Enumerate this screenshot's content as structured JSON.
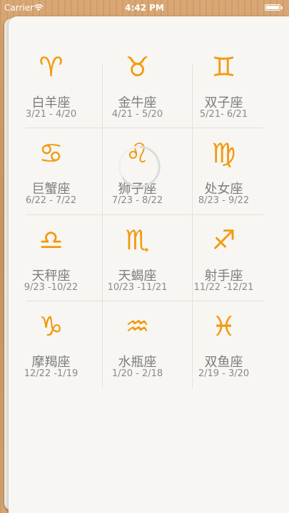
{
  "status_bar": {
    "carrier": "Carrier",
    "time": "4:42 PM"
  },
  "signs": [
    {
      "glyph": "♈",
      "name": "白羊座",
      "dates": "3/21 - 4/20",
      "icon": "aries-icon"
    },
    {
      "glyph": "♉",
      "name": "金牛座",
      "dates": "4/21 - 5/20",
      "icon": "taurus-icon"
    },
    {
      "glyph": "♊",
      "name": "双子座",
      "dates": "5/21- 6/21",
      "icon": "gemini-icon"
    },
    {
      "glyph": "♋",
      "name": "巨蟹座",
      "dates": "6/22 - 7/22",
      "icon": "cancer-icon"
    },
    {
      "glyph": "♌",
      "name": "狮子座",
      "dates": "7/23 - 8/22",
      "icon": "leo-icon"
    },
    {
      "glyph": "♍",
      "name": "处女座",
      "dates": "8/23 - 9/22",
      "icon": "virgo-icon"
    },
    {
      "glyph": "♎",
      "name": "天秤座",
      "dates": "9/23 -10/22",
      "icon": "libra-icon"
    },
    {
      "glyph": "♏",
      "name": "天蝎座",
      "dates": "10/23 -11/21",
      "icon": "scorpio-icon"
    },
    {
      "glyph": "♐",
      "name": "射手座",
      "dates": "11/22 -12/21",
      "icon": "sagittarius-icon"
    },
    {
      "glyph": "♑",
      "name": "摩羯座",
      "dates": "12/22 -1/19",
      "icon": "capricorn-icon"
    },
    {
      "glyph": "♒",
      "name": "水瓶座",
      "dates": "1/20 - 2/18",
      "icon": "aquarius-icon"
    },
    {
      "glyph": "♓",
      "name": "双鱼座",
      "dates": "2/19 - 3/20",
      "icon": "pisces-icon"
    }
  ],
  "colors": {
    "accent": "#f29a10",
    "text": "#7d7d7d",
    "panel": "#f7f6f2"
  }
}
